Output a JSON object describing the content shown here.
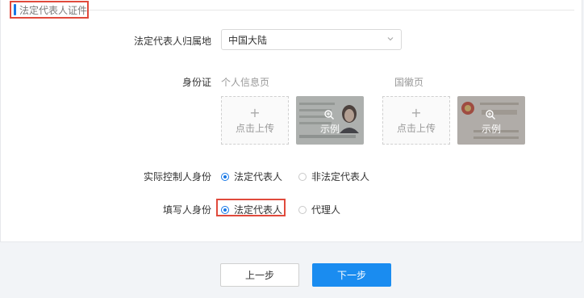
{
  "section": {
    "title": "法定代表人证件"
  },
  "region": {
    "label": "法定代表人归属地",
    "selected": "中国大陆",
    "icon": "chevron-down-icon"
  },
  "id_card": {
    "label": "身份证",
    "front": {
      "caption": "个人信息页",
      "upload_text": "点击上传",
      "sample_text": "示例"
    },
    "back": {
      "caption": "国徽页",
      "upload_text": "点击上传",
      "sample_text": "示例"
    }
  },
  "controller": {
    "label": "实际控制人身份",
    "options": [
      "法定代表人",
      "非法定代表人"
    ],
    "selected": "法定代表人"
  },
  "filler": {
    "label": "填写人身份",
    "options": [
      "法定代表人",
      "代理人"
    ],
    "selected": "法定代表人"
  },
  "buttons": {
    "prev": "上一步",
    "next": "下一步"
  },
  "colors": {
    "accent": "#1677e6",
    "highlight": "#e04a3c",
    "primary_button": "#1a8cf0"
  }
}
